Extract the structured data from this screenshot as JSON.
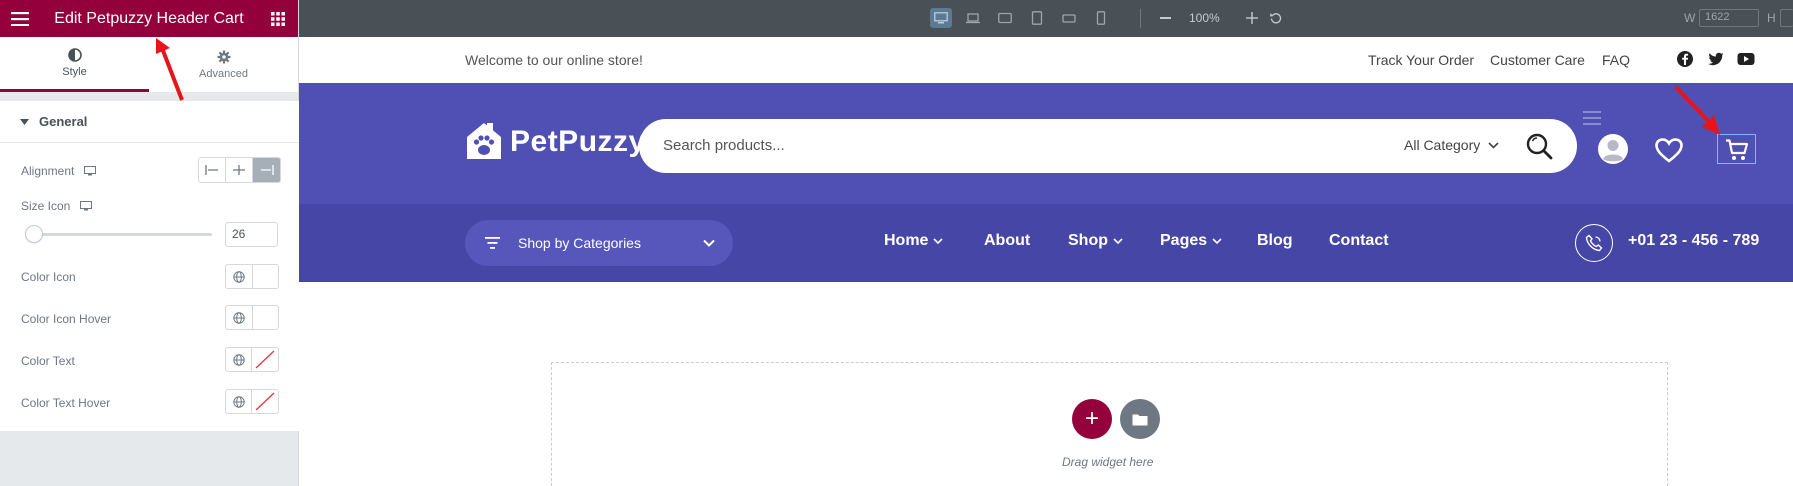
{
  "editor": {
    "panel_title": "Edit Petpuzzy Header Cart",
    "tabs": [
      {
        "label": "Style",
        "icon": "half-circle-icon"
      },
      {
        "label": "Advanced",
        "icon": "gear-icon"
      }
    ],
    "section_title": "General",
    "controls": {
      "alignment_label": "Alignment",
      "size_icon_label": "Size Icon",
      "size_icon_value": "26",
      "color_icon_label": "Color Icon",
      "color_icon_hover_label": "Color Icon Hover",
      "color_text_label": "Color Text",
      "color_text_hover_label": "Color Text Hover"
    },
    "colors": {
      "accent": "#93003c",
      "panel_bg": "#e6e9ec"
    }
  },
  "toolbar": {
    "zoom": "100%",
    "width_label": "W",
    "width_value": "1622",
    "height_label": "H"
  },
  "site": {
    "welcome": "Welcome to our online store!",
    "top_links": [
      "Track Your Order",
      "Customer Care",
      "FAQ"
    ],
    "social": [
      "facebook-icon",
      "twitter-icon",
      "youtube-icon"
    ],
    "logo_text": "PetPuzzy",
    "search_placeholder": "Search products...",
    "category_select": "All Category",
    "category_button": "Shop by Categories",
    "nav": [
      "Home",
      "About",
      "Shop",
      "Pages",
      "Blog",
      "Contact"
    ],
    "phone": "+01 23 - 456 - 789",
    "drag_text": "Drag widget here",
    "colors": {
      "header": "#5050b4",
      "nav": "#4646a6"
    }
  }
}
